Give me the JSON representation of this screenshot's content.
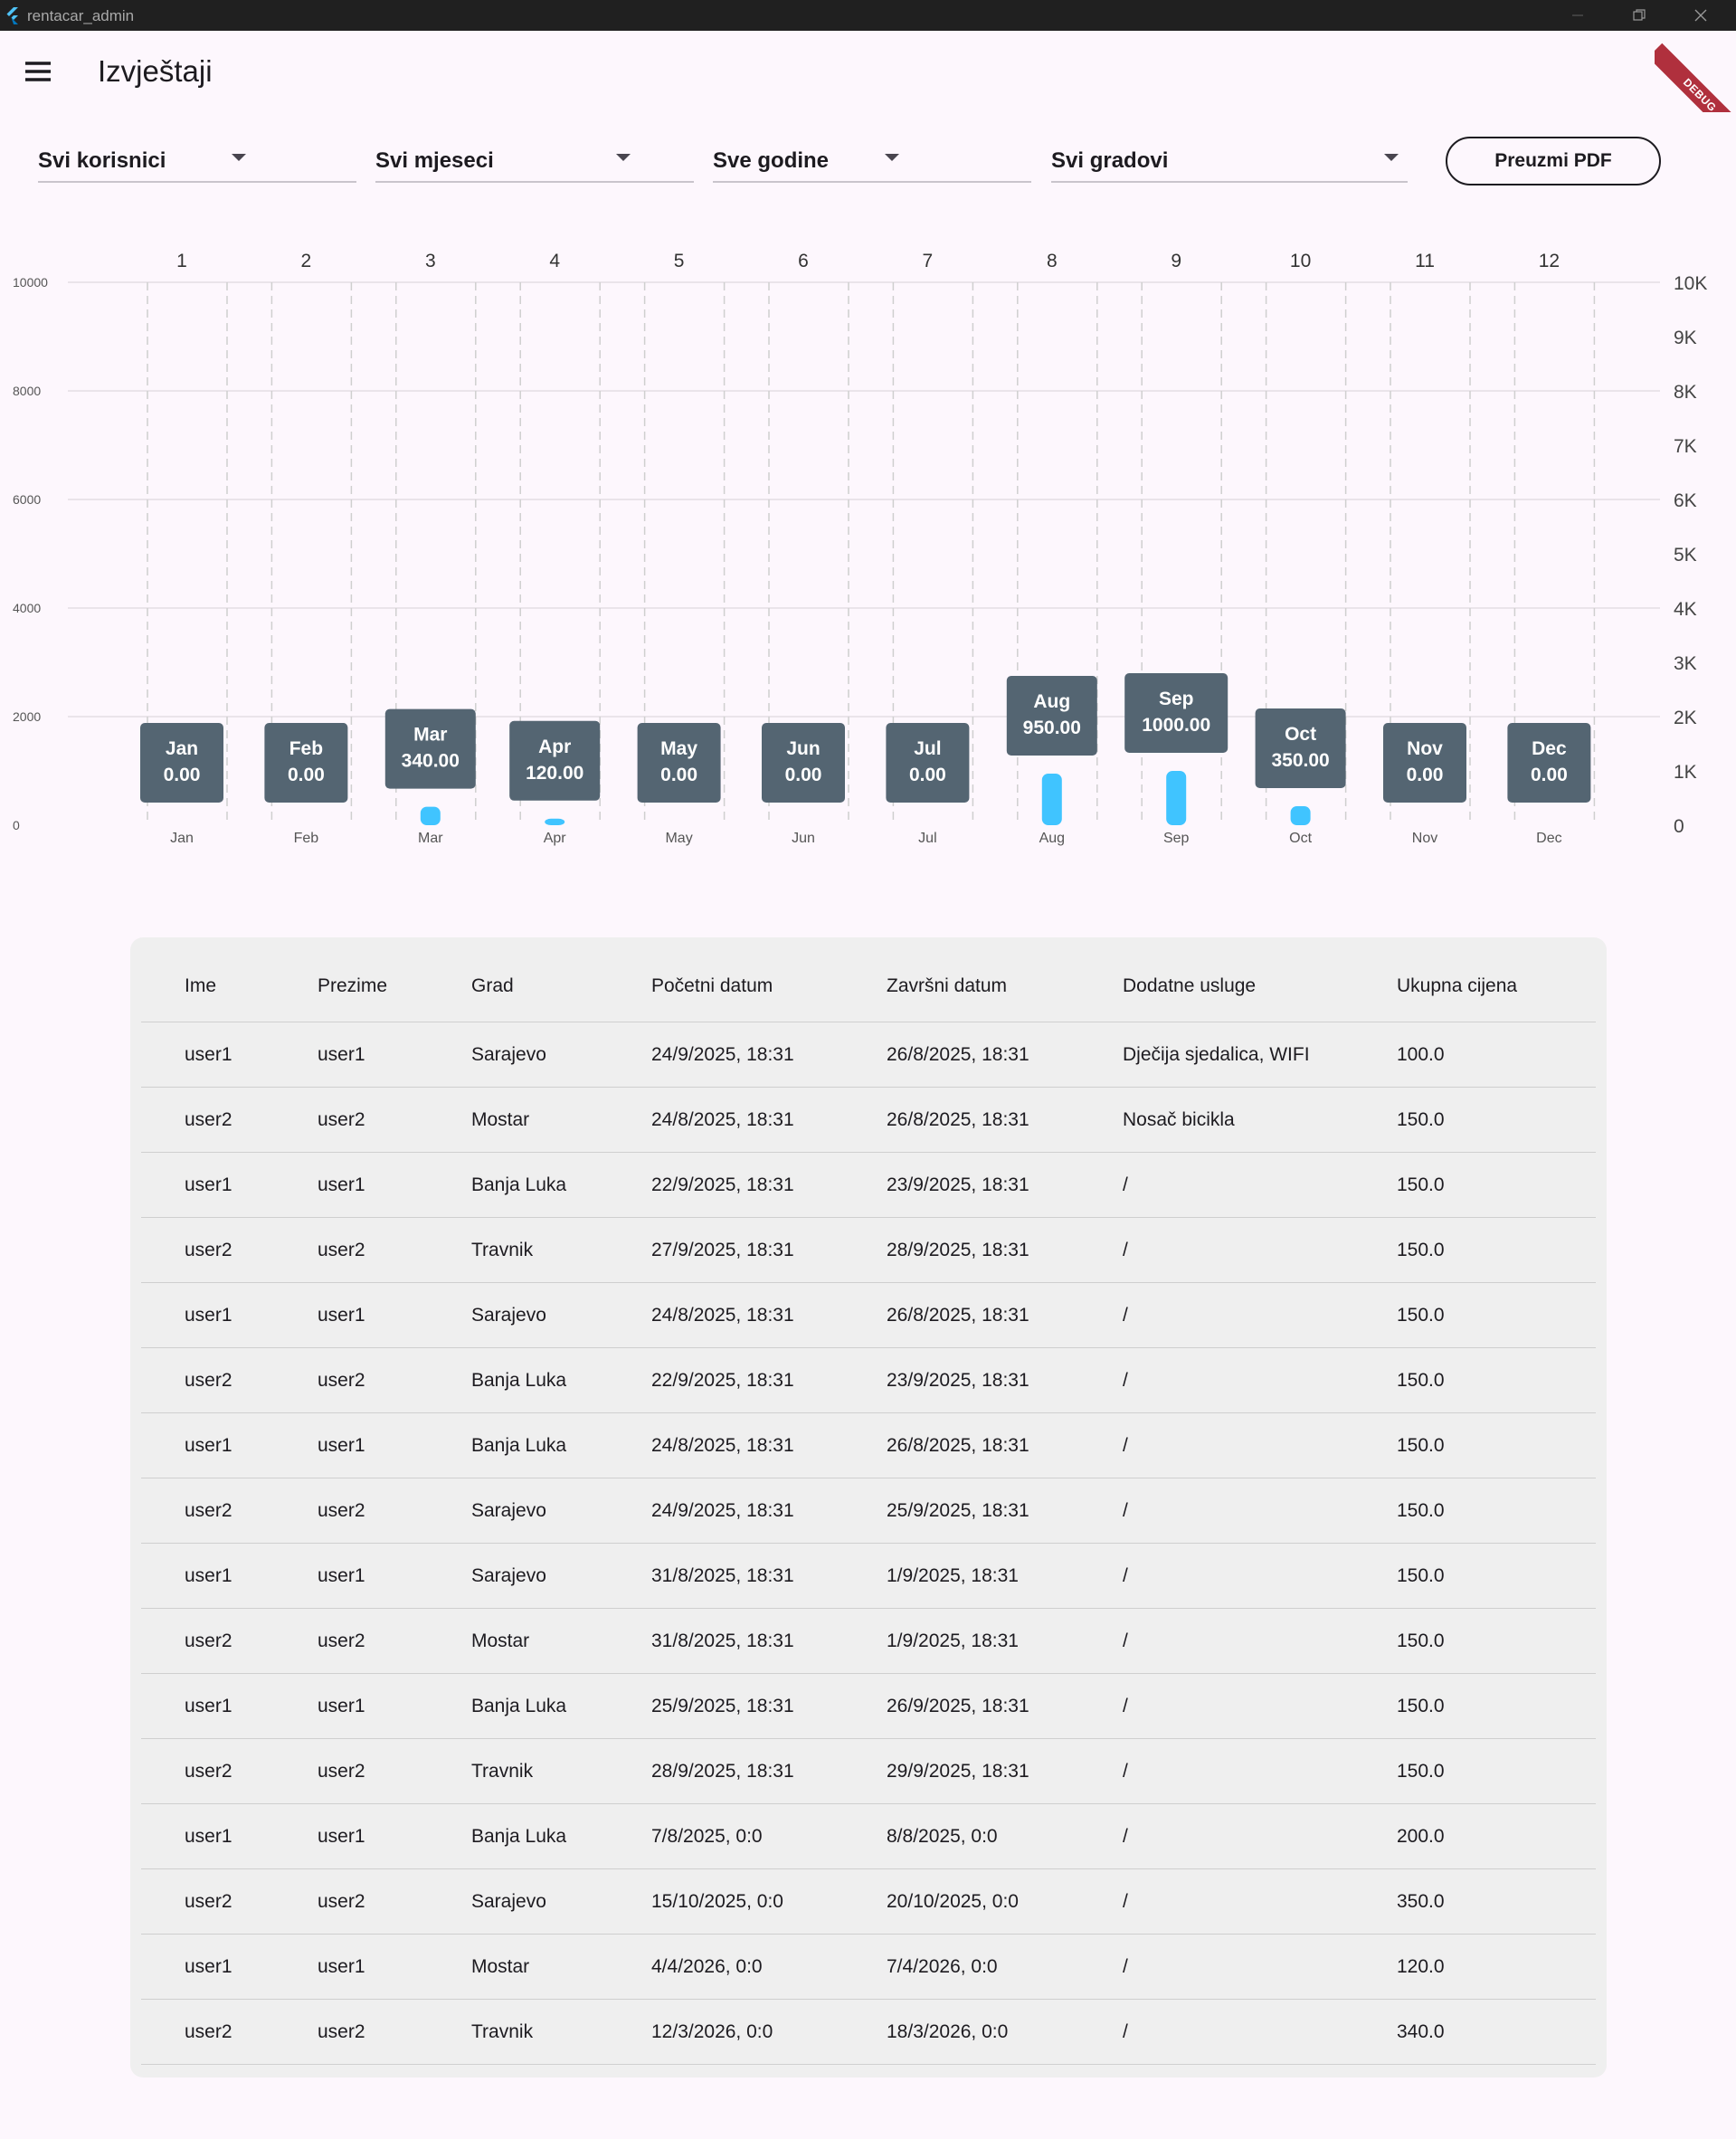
{
  "window": {
    "title": "rentacar_admin"
  },
  "appbar": {
    "title": "Izvještaji",
    "debug_label": "DEBUG"
  },
  "filters": {
    "user": "Svi korisnici",
    "month": "Svi mjeseci",
    "year": "Sve godine",
    "city": "Svi gradovi",
    "pdf_button": "Preuzmi PDF"
  },
  "colors": {
    "bar": "#40c4ff",
    "tooltip": "#546572",
    "background": "#fdf7fd"
  },
  "chart_data": {
    "type": "bar",
    "categories": [
      "Jan",
      "Feb",
      "Mar",
      "Apr",
      "May",
      "Jun",
      "Jul",
      "Aug",
      "Sep",
      "Oct",
      "Nov",
      "Dec"
    ],
    "top_labels": [
      "1",
      "2",
      "3",
      "4",
      "5",
      "6",
      "7",
      "8",
      "9",
      "10",
      "11",
      "12"
    ],
    "values": [
      0,
      0,
      340,
      120,
      0,
      0,
      0,
      950,
      1000,
      350,
      0,
      0
    ],
    "tooltips": [
      "Jan\n0.00",
      "Feb\n0.00",
      "Mar\n340.00",
      "Apr\n120.00",
      "May\n0.00",
      "Jun\n0.00",
      "Jul\n0.00",
      "Aug\n950.00",
      "Sep\n1000.00",
      "Oct\n350.00",
      "Nov\n0.00",
      "Dec\n0.00"
    ],
    "left_ticks": [
      "0",
      "2000",
      "4000",
      "6000",
      "8000",
      "10000"
    ],
    "right_ticks": [
      "0",
      "1K",
      "2K",
      "3K",
      "4K",
      "5K",
      "6K",
      "7K",
      "8K",
      "9K",
      "10K"
    ],
    "ylim": [
      0,
      10000
    ],
    "grid": true
  },
  "table": {
    "headers": [
      "Ime",
      "Prezime",
      "Grad",
      "Početni datum",
      "Završni datum",
      "Dodatne usluge",
      "Ukupna cijena"
    ],
    "rows": [
      [
        "user1",
        "user1",
        "Sarajevo",
        "24/9/2025, 18:31",
        "26/8/2025, 18:31",
        "Dječija sjedalica, WIFI",
        "100.0"
      ],
      [
        "user2",
        "user2",
        "Mostar",
        "24/8/2025, 18:31",
        "26/8/2025, 18:31",
        "Nosač bicikla",
        "150.0"
      ],
      [
        "user1",
        "user1",
        "Banja Luka",
        "22/9/2025, 18:31",
        "23/9/2025, 18:31",
        "/",
        "150.0"
      ],
      [
        "user2",
        "user2",
        "Travnik",
        "27/9/2025, 18:31",
        "28/9/2025, 18:31",
        "/",
        "150.0"
      ],
      [
        "user1",
        "user1",
        "Sarajevo",
        "24/8/2025, 18:31",
        "26/8/2025, 18:31",
        "/",
        "150.0"
      ],
      [
        "user2",
        "user2",
        "Banja Luka",
        "22/9/2025, 18:31",
        "23/9/2025, 18:31",
        "/",
        "150.0"
      ],
      [
        "user1",
        "user1",
        "Banja Luka",
        "24/8/2025, 18:31",
        "26/8/2025, 18:31",
        "/",
        "150.0"
      ],
      [
        "user2",
        "user2",
        "Sarajevo",
        "24/9/2025, 18:31",
        "25/9/2025, 18:31",
        "/",
        "150.0"
      ],
      [
        "user1",
        "user1",
        "Sarajevo",
        "31/8/2025, 18:31",
        "1/9/2025, 18:31",
        "/",
        "150.0"
      ],
      [
        "user2",
        "user2",
        "Mostar",
        "31/8/2025, 18:31",
        "1/9/2025, 18:31",
        "/",
        "150.0"
      ],
      [
        "user1",
        "user1",
        "Banja Luka",
        "25/9/2025, 18:31",
        "26/9/2025, 18:31",
        "/",
        "150.0"
      ],
      [
        "user2",
        "user2",
        "Travnik",
        "28/9/2025, 18:31",
        "29/9/2025, 18:31",
        "/",
        "150.0"
      ],
      [
        "user1",
        "user1",
        "Banja Luka",
        "7/8/2025, 0:0",
        "8/8/2025, 0:0",
        "/",
        "200.0"
      ],
      [
        "user2",
        "user2",
        "Sarajevo",
        "15/10/2025, 0:0",
        "20/10/2025, 0:0",
        "/",
        "350.0"
      ],
      [
        "user1",
        "user1",
        "Mostar",
        "4/4/2026, 0:0",
        "7/4/2026, 0:0",
        "/",
        "120.0"
      ],
      [
        "user2",
        "user2",
        "Travnik",
        "12/3/2026, 0:0",
        "18/3/2026, 0:0",
        "/",
        "340.0"
      ]
    ]
  }
}
